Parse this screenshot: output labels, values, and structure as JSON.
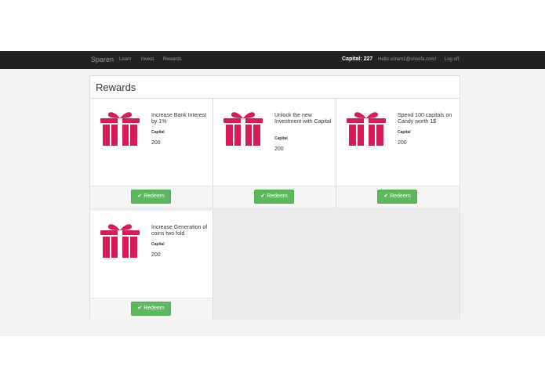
{
  "navbar": {
    "brand": "Sparen",
    "links": [
      "Learn",
      "Invest",
      "Rewards"
    ],
    "capital_label": "Capital: 227",
    "hello": "Hello sriram1@shoofa.com!",
    "logout": "Log off"
  },
  "rewards": {
    "title": "Rewards",
    "items": [
      {
        "title": "Increase Bank Interest by 1%",
        "label": "Capital",
        "value": "200",
        "button": "Redeem"
      },
      {
        "title": "Unlock the new Investment with Capital",
        "label": "Capital",
        "value": "200",
        "button": "Redeem"
      },
      {
        "title": "Spend 100 capitals on Candy worth 1$",
        "label": "Capital",
        "value": "200",
        "button": "Redeem"
      },
      {
        "title": "Increase Generation of coins two fold",
        "label": "Capital",
        "value": "200",
        "button": "Redeem"
      }
    ]
  },
  "colors": {
    "gift": "#d81b55",
    "redeem": "#5cb85c",
    "navbar": "#222222"
  },
  "icons": {
    "gift": "gift-icon",
    "check": "check-icon"
  }
}
